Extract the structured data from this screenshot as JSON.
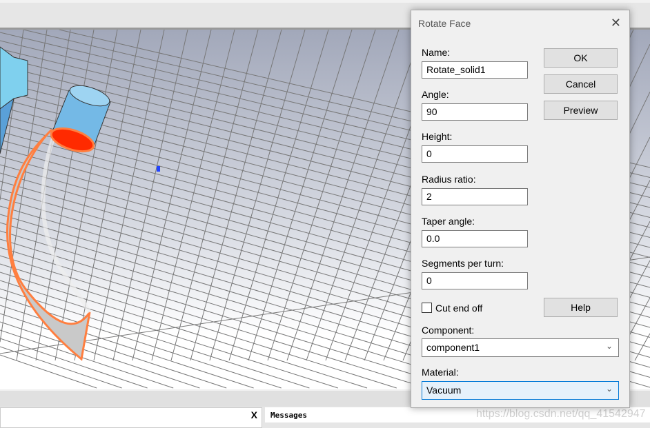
{
  "dialog": {
    "title": "Rotate Face",
    "fields": [
      {
        "label": "Name:",
        "value": "Rotate_solid1"
      },
      {
        "label": "Angle:",
        "value": "90"
      },
      {
        "label": "Height:",
        "value": "0"
      },
      {
        "label": "Radius ratio:",
        "value": "2"
      },
      {
        "label": "Taper angle:",
        "value": "0.0"
      },
      {
        "label": "Segments per turn:",
        "value": "0"
      }
    ],
    "buttons": {
      "ok": "OK",
      "cancel": "Cancel",
      "preview": "Preview",
      "help": "Help"
    },
    "cut_end_off": {
      "label": "Cut end off",
      "checked": false
    },
    "component": {
      "label": "Component:",
      "value": "component1"
    },
    "material": {
      "label": "Material:",
      "value": "Vacuum"
    }
  },
  "panels": {
    "left_close": "X",
    "messages": "Messages"
  },
  "watermark": "https://blog.csdn.net/qq_41542947",
  "colors": {
    "annotation_arrow": "#e8333a",
    "selected_face": "#ff2a00",
    "face_outline": "#ff7f40"
  }
}
